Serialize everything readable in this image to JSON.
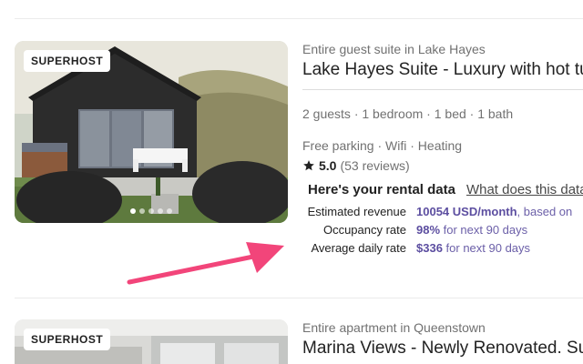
{
  "listings": [
    {
      "badge": "SUPERHOST",
      "subtitle": "Entire guest suite in Lake Hayes",
      "title": "Lake Hayes Suite - Luxury with hot tub",
      "details": "2 guests · 1 bedroom · 1 bed · 1 bath",
      "amenities": "Free parking · Wifi · Heating",
      "rating": "5.0",
      "reviews": "(53 reviews)",
      "rental_data": {
        "label": "Here's your rental data",
        "link": "What does this data mean?",
        "stats": [
          {
            "label": "Estimated revenue",
            "value": "10054 USD/month",
            "suffix": ", based on"
          },
          {
            "label": "Occupancy rate",
            "value": "98%",
            "suffix": " for next 90 days"
          },
          {
            "label": "Average daily rate",
            "value": "$336",
            "suffix": " for next 90 days"
          }
        ]
      }
    },
    {
      "badge": "SUPERHOST",
      "subtitle": "Entire apartment in Queenstown",
      "title": "Marina Views - Newly Renovated. Sunny"
    }
  ],
  "colors": {
    "annotation_arrow": "#f2457a",
    "brand_icon": "#ff5a5f",
    "stat_value": "#5c4ea0",
    "star": "#222222"
  }
}
